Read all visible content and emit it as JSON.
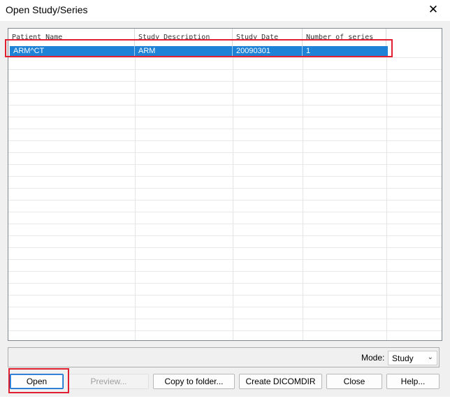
{
  "window": {
    "title": "Open Study/Series",
    "close_glyph": "✕"
  },
  "table": {
    "columns": [
      "Patient Name",
      "Study Description",
      "Study Date",
      "Number of series"
    ],
    "rows": [
      {
        "patient_name": "ARM^CT",
        "study_description": "ARM",
        "study_date": "20090301",
        "number_of_series": "1",
        "selected": true
      }
    ]
  },
  "mode": {
    "label": "Mode:",
    "value": "Study"
  },
  "buttons": {
    "open": "Open",
    "preview": "Preview...",
    "copy_to_folder": "Copy to folder...",
    "create_dicomdir": "Create DICOMDIR",
    "close": "Close",
    "help": "Help..."
  },
  "colors": {
    "selection": "#1e82d7",
    "highlight_box": "#e02030"
  }
}
